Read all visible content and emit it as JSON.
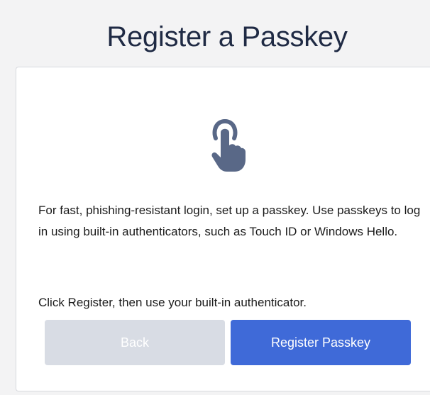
{
  "header": {
    "title": "Register a Passkey"
  },
  "card": {
    "icon": "touch-finger-icon",
    "description": "For fast, phishing-resistant login, set up a passkey. Use passkeys to log in using built-in authenticators, such as Touch ID or Windows Hello.",
    "instruction": "Click Register, then use your built-in authenticator."
  },
  "actions": {
    "back_label": "Back",
    "back_state": "disabled",
    "register_label": "Register Passkey"
  },
  "colors": {
    "primary": "#3f6ad8",
    "disabled": "#d8dce4",
    "icon": "#596887",
    "title_text": "#1f2a44"
  }
}
